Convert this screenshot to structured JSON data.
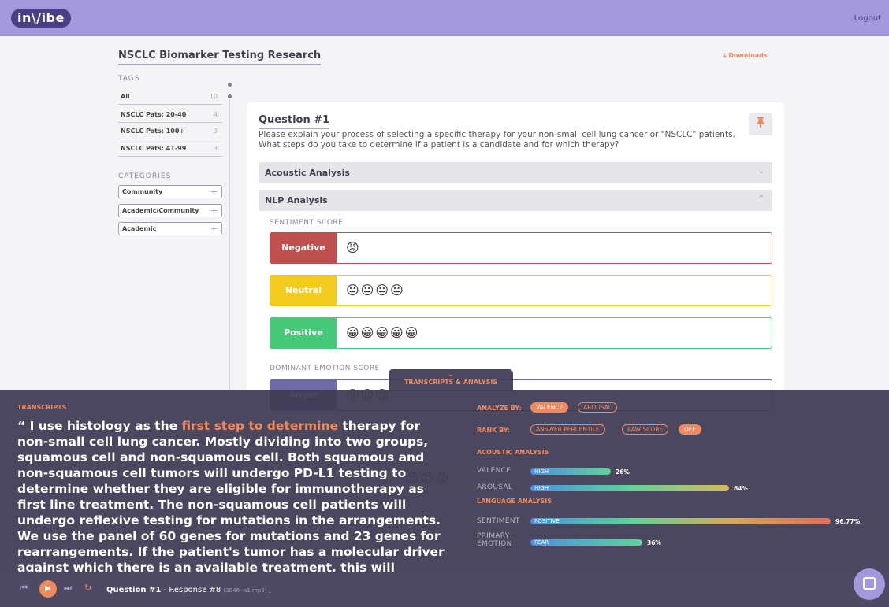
{
  "header": {
    "logo": "in\\/ibe",
    "logout": "Logout"
  },
  "page": {
    "title": "NSCLC Biomarker Testing Research",
    "downloads": "⤓ Downloads"
  },
  "sidebar": {
    "tags_heading": "TAGS",
    "tags": [
      {
        "label": "All",
        "count": "10"
      },
      {
        "label": "NSCLC Pats: 20-40",
        "count": "4"
      },
      {
        "label": "NSCLC Pats: 100+",
        "count": "3"
      },
      {
        "label": "NSCLC Pats: 41-99",
        "count": "3"
      }
    ],
    "categories_heading": "CATEGORIES",
    "categories": [
      "Community",
      "Academic/Community",
      "Academic"
    ],
    "plus": "+"
  },
  "question": {
    "title": "Question #1",
    "text": "Please explain your process of selecting a specific therapy for your non-small cell lung cancer or \"NSCLC\" patients. What steps do you take to determine if a patient is a candidate and for which therapy?",
    "pin_icon": "pin-icon"
  },
  "accordions": {
    "acoustic": "Acoustic Analysis",
    "nlp": "NLP Analysis",
    "chevron_down": "⌄",
    "chevron_up": "⌃"
  },
  "sentiment": {
    "heading": "SENTIMENT SCORE",
    "negative": {
      "label": "Negative",
      "emojis": "😡"
    },
    "neutral": {
      "label": "Neutral",
      "emojis": "😐😐😐😐"
    },
    "positive": {
      "label": "Positive",
      "emojis": "😀😀😀😀😀"
    }
  },
  "emotion": {
    "heading": "DOMINANT EMOTION SCORE",
    "anger": {
      "label": "Anger",
      "emojis": "😡😡😡"
    },
    "partial_emojis": "😡😡😡"
  },
  "overlay": {
    "tab_chevron": "⌄",
    "tab_label": "TRANSCRIPTS & ANALYSIS",
    "transcripts_heading": "TRANSCRIPTS",
    "transcript_prefix": "“ I use histology as the ",
    "transcript_highlight": "first step to determine",
    "transcript_rest": " therapy for non-small cell lung cancer. Mostly dividing into two groups, squamous cell and non-squamous cell. Both squamous and non-squamous cell tumors will undergo PD-L1 testing to determine whether they are eligible for immunotherapy as first line treatment. The non-squamous cell patients will undergo reflexive testing for mutations in the arrangements. We use the panel of 60 genes for mutations and 23 genes for rearrangements. If the patient's tumor has a molecular driver against which there is an available treatment, this will",
    "analyze_by": "ANALYZE BY:",
    "analyze_options": [
      "VALENCE",
      "AROUSAL"
    ],
    "rank_by": "RANK BY:",
    "rank_options": [
      "ANSWER PERCENTILE",
      "RAW SCORE",
      "OFF"
    ],
    "acoustic_heading": "ACOUSTIC ANALYSIS",
    "language_heading": "LANGUAGE ANALYSIS",
    "metrics": {
      "valence": {
        "label": "VALENCE",
        "bar_label": "HIGH",
        "value": 0.26,
        "pct": "26%"
      },
      "arousal": {
        "label": "AROUSAL",
        "bar_label": "HIGH",
        "value": 0.64,
        "pct": "64%"
      },
      "sentiment": {
        "label": "SENTIMENT",
        "bar_label": "POSITIVE",
        "value": 0.9677,
        "pct": "96.77%"
      },
      "primary_emotion": {
        "label_line1": "PRIMARY",
        "label_line2": "EMOTION",
        "bar_label": "FEAR",
        "value": 0.36,
        "pct": "36%"
      }
    },
    "colors": {
      "accent": "#f08a5d",
      "overlay": "#403c54"
    }
  },
  "player": {
    "prev_icon": "⏮",
    "play_icon": "▶",
    "next_icon": "⏭",
    "repeat_icon": "↻",
    "question": "Question #1",
    "response": " - Response #8",
    "file": "(3646--a1.mp3) ⤓"
  }
}
